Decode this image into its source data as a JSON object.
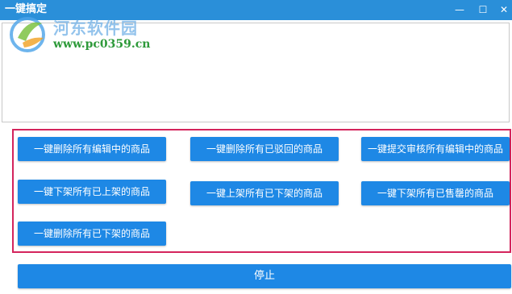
{
  "window": {
    "title": "一键搞定",
    "controls": {
      "minimize": "—",
      "maximize": "☐",
      "close": "✕"
    }
  },
  "watermark": {
    "site_name": "河东软件园",
    "url": "www.pc0359.cn"
  },
  "output_area": {
    "text": ""
  },
  "actions": [
    {
      "label": "一键删除所有编辑中的商品"
    },
    {
      "label": "一键删除所有已驳回的商品"
    },
    {
      "label": "一键提交审核所有编辑中的商品"
    },
    {
      "label": "一键下架所有已上架的商品"
    },
    {
      "label": "一键上架所有已下架的商品"
    },
    {
      "label": "一键下架所有已售罄的商品"
    },
    {
      "label": "一键删除所有已下架的商品"
    }
  ],
  "stop_button": {
    "label": "停止"
  },
  "colors": {
    "titlebar": "#2a8fd9",
    "button": "#1e88e5",
    "panel_border": "#d4245c"
  }
}
